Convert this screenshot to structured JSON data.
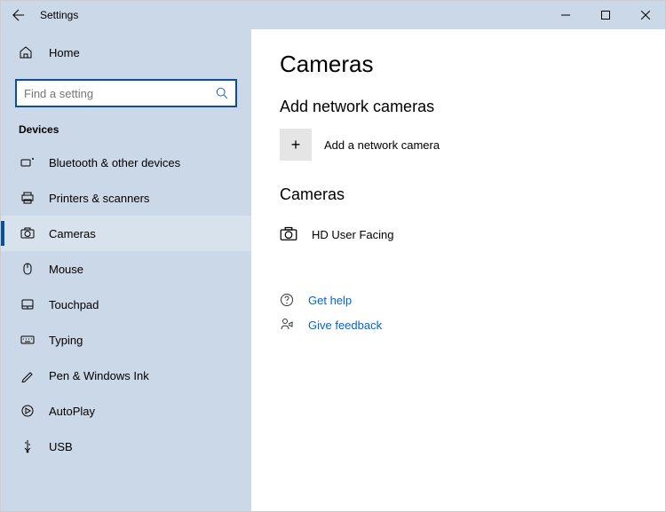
{
  "window": {
    "title": "Settings"
  },
  "sidebar": {
    "home_label": "Home",
    "search_placeholder": "Find a setting",
    "group_label": "Devices",
    "items": [
      {
        "label": "Bluetooth & other devices"
      },
      {
        "label": "Printers & scanners"
      },
      {
        "label": "Cameras"
      },
      {
        "label": "Mouse"
      },
      {
        "label": "Touchpad"
      },
      {
        "label": "Typing"
      },
      {
        "label": "Pen & Windows Ink"
      },
      {
        "label": "AutoPlay"
      },
      {
        "label": "USB"
      }
    ]
  },
  "main": {
    "page_title": "Cameras",
    "section_add_title": "Add network cameras",
    "add_network_label": "Add a network camera",
    "section_list_title": "Cameras",
    "camera_items": [
      {
        "name": "HD User Facing"
      }
    ],
    "help_label": "Get help",
    "feedback_label": "Give feedback"
  }
}
